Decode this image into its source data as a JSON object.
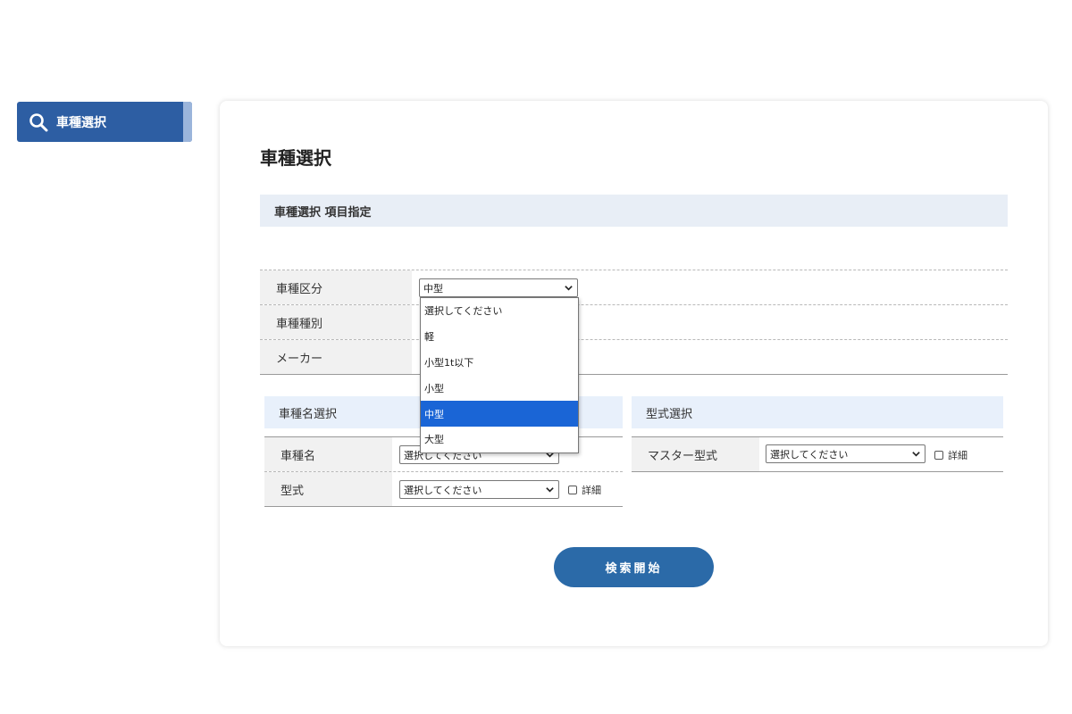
{
  "sidebar": {
    "nav_label": "車種選択"
  },
  "main": {
    "title": "車種選択",
    "section_header": "車種選択 項目指定",
    "attributes": [
      {
        "label": "車種区分",
        "value": "中型"
      },
      {
        "label": "車種種別"
      },
      {
        "label": "メーカー"
      }
    ],
    "dropdown_options": [
      "選択してください",
      "軽",
      "小型1t以下",
      "小型",
      "中型",
      "大型"
    ],
    "dropdown_selected": "中型",
    "name_panel": {
      "header": "車種名選択",
      "rows": [
        {
          "label": "車種名",
          "select_value": "選択してください"
        },
        {
          "label": "型式",
          "select_value": "選択してください",
          "checkbox_label": "詳細"
        }
      ]
    },
    "model_panel": {
      "header": "型式選択",
      "rows": [
        {
          "label": "マスター型式",
          "select_value": "選択してください",
          "checkbox_label": "詳細"
        }
      ]
    },
    "search_button": "検索開始"
  },
  "colors": {
    "accent": "#2d5ea3",
    "button": "#2b6aa8",
    "highlight": "#1a65d6",
    "header_bg": "#e8eef6"
  }
}
